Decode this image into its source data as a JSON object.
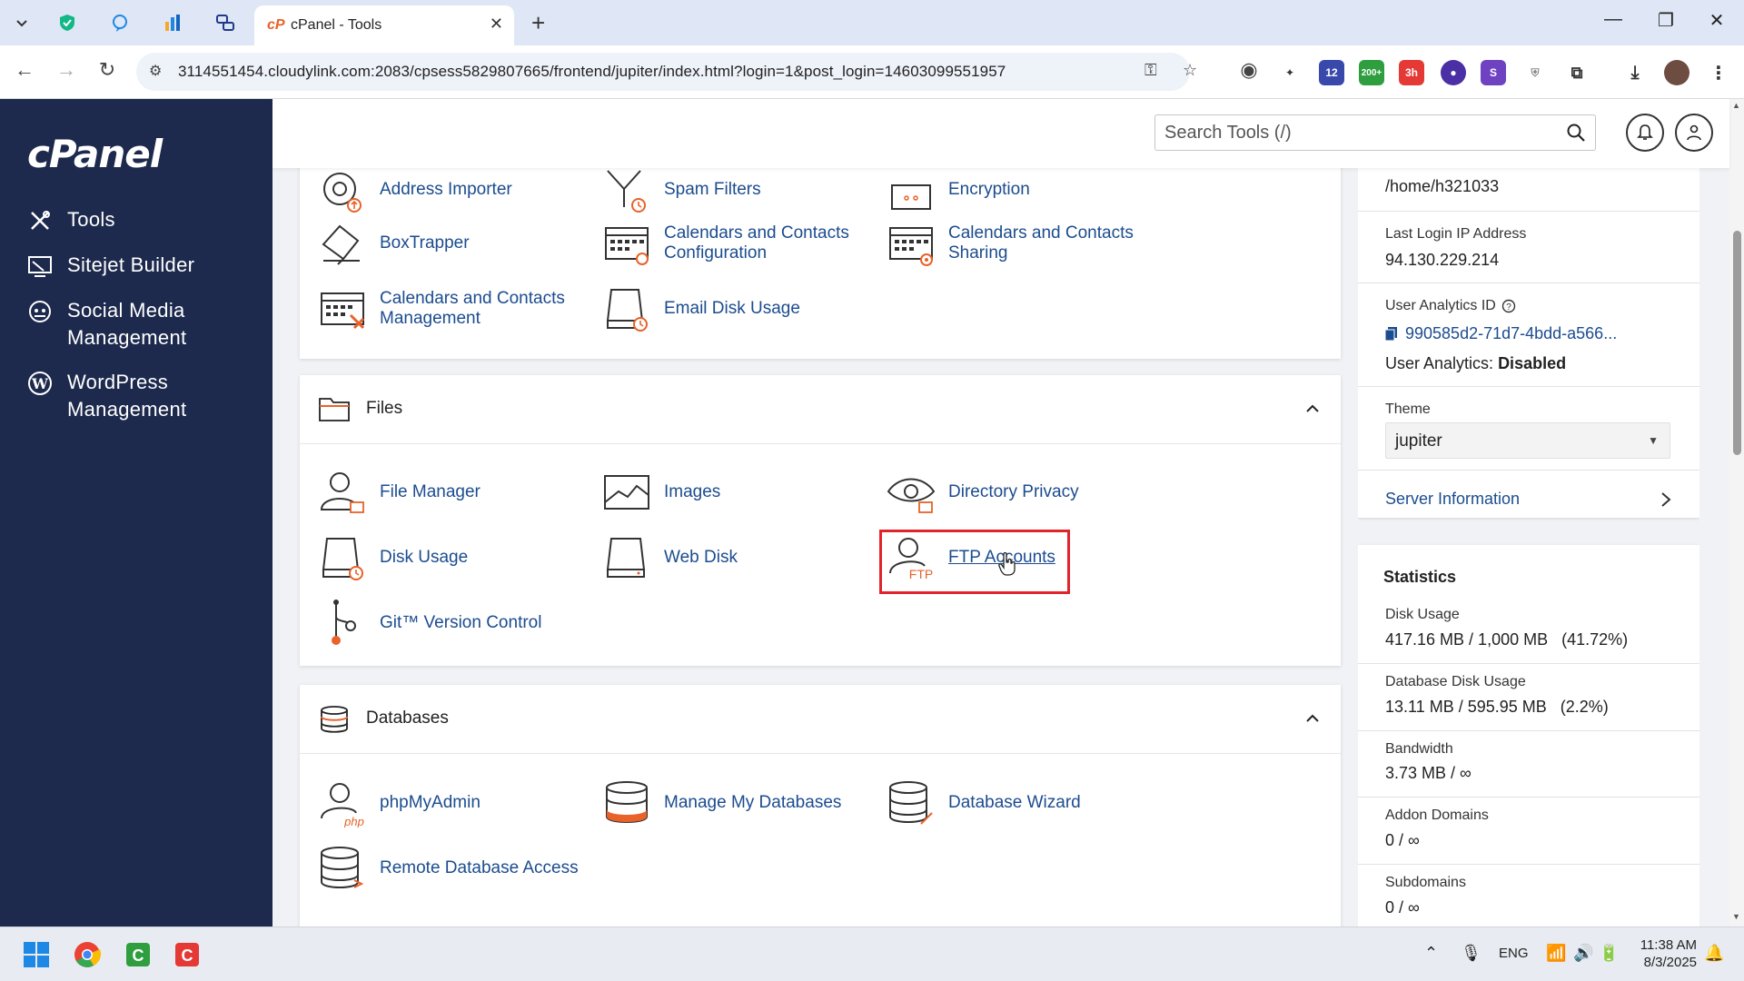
{
  "browser": {
    "tab_title": "cPanel - Tools",
    "url": "3114551454.cloudylink.com:2083/cpsess5829807665/frontend/jupiter/index.html?login=1&post_login=14603099551957",
    "ext_badges": [
      "12",
      "200+",
      "3h"
    ]
  },
  "sidebar": {
    "logo": "cPanel",
    "items": [
      {
        "label": "Tools",
        "icon": "tools-icon"
      },
      {
        "label": "Sitejet Builder",
        "icon": "sitejet-icon"
      },
      {
        "label": "Social Media Management",
        "icon": "social-media-icon"
      },
      {
        "label": "WordPress Management",
        "icon": "wordpress-icon"
      }
    ]
  },
  "header": {
    "search_placeholder": "Search Tools (/)"
  },
  "email_tools": [
    {
      "label": "Address Importer",
      "icon": "address-importer-icon"
    },
    {
      "label": "Spam Filters",
      "icon": "spam-filters-icon"
    },
    {
      "label": "Encryption",
      "icon": "encryption-icon"
    },
    {
      "label": "BoxTrapper",
      "icon": "boxtrapper-icon"
    },
    {
      "label": "Calendars and Contacts Configuration",
      "icon": "calendar-config-icon"
    },
    {
      "label": "Calendars and Contacts Sharing",
      "icon": "calendar-sharing-icon"
    },
    {
      "label": "Calendars and Contacts Management",
      "icon": "calendar-management-icon"
    },
    {
      "label": "Email Disk Usage",
      "icon": "email-disk-usage-icon"
    }
  ],
  "files": {
    "title": "Files",
    "tools": [
      {
        "label": "File Manager",
        "icon": "file-manager-icon"
      },
      {
        "label": "Images",
        "icon": "images-icon"
      },
      {
        "label": "Directory Privacy",
        "icon": "directory-privacy-icon"
      },
      {
        "label": "Disk Usage",
        "icon": "disk-usage-icon"
      },
      {
        "label": "Web Disk",
        "icon": "web-disk-icon"
      },
      {
        "label": "FTP Accounts",
        "icon": "ftp-accounts-icon"
      },
      {
        "label": "Git™ Version Control",
        "icon": "git-icon"
      }
    ]
  },
  "databases": {
    "title": "Databases",
    "tools": [
      {
        "label": "phpMyAdmin",
        "icon": "phpmyadmin-icon"
      },
      {
        "label": "Manage My Databases",
        "icon": "manage-databases-icon"
      },
      {
        "label": "Database Wizard",
        "icon": "database-wizard-icon"
      },
      {
        "label": "Remote Database Access",
        "icon": "remote-database-icon"
      }
    ]
  },
  "general_info": {
    "home_dir": "/home/h321033",
    "last_login_label": "Last Login IP Address",
    "last_login_value": "94.130.229.214",
    "analytics_id_label": "User Analytics ID",
    "analytics_id_value": "990585d2-71d7-4bdd-a566...",
    "analytics_status_label": "User Analytics:",
    "analytics_status_value": "Disabled",
    "theme_label": "Theme",
    "theme_value": "jupiter",
    "server_info": "Server Information"
  },
  "statistics": {
    "title": "Statistics",
    "items": [
      {
        "label": "Disk Usage",
        "value": "417.16 MB / 1,000 MB   (41.72%)"
      },
      {
        "label": "Database Disk Usage",
        "value": "13.11 MB / 595.95 MB   (2.2%)"
      },
      {
        "label": "Bandwidth",
        "value": "3.73 MB / ∞"
      },
      {
        "label": "Addon Domains",
        "value": "0 / ∞"
      },
      {
        "label": "Subdomains",
        "value": "0 / ∞"
      }
    ]
  },
  "taskbar": {
    "lang": "ENG",
    "time": "11:38 AM",
    "date": "8/3/2025"
  },
  "colors": {
    "sidebar_bg": "#1d2a4d",
    "link_blue": "#1b4c8f",
    "accent_orange": "#e8622a",
    "highlight_red": "#e0242b"
  }
}
